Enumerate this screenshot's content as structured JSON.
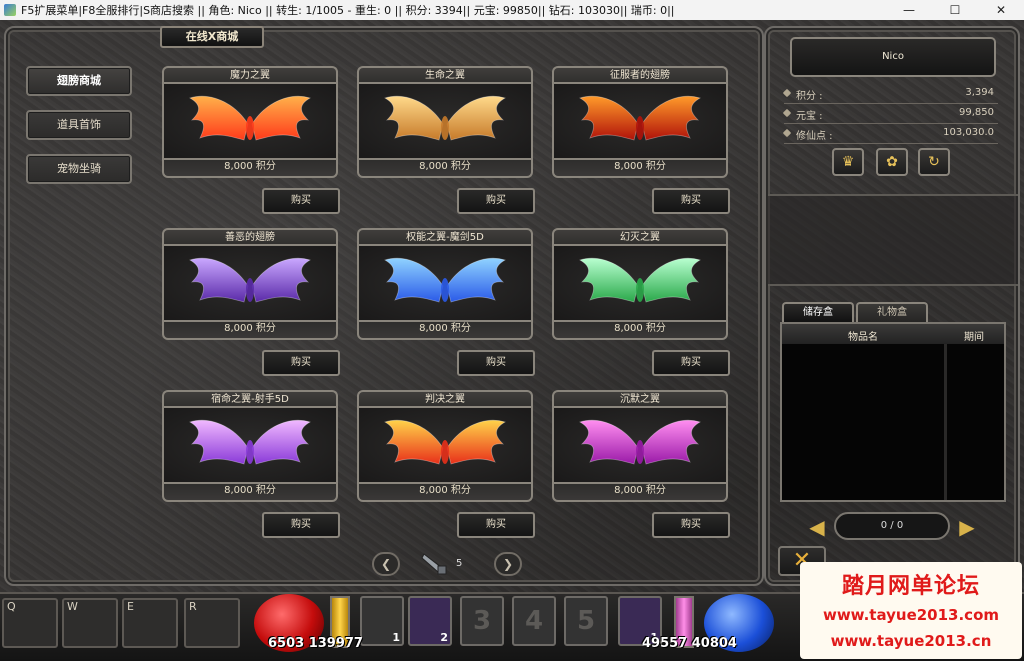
{
  "window": {
    "title": "F5扩展菜单|F8全服排行|S商店搜索 || 角色: Nico || 转生: 1/1005 - 重生: 0 || 积分: 3394|| 元宝: 99850|| 钻石: 103030|| 瑞币: 0||",
    "controls": {
      "minimize": "—",
      "maximize": "☐",
      "close": "✕"
    }
  },
  "shop": {
    "tab_title": "在线X商城",
    "categories": [
      {
        "label": "翅膀商城",
        "active": true
      },
      {
        "label": "道具首饰",
        "active": false
      },
      {
        "label": "宠物坐骑",
        "active": false
      }
    ],
    "buy_label": "购买",
    "items": [
      {
        "name": "魔力之翼",
        "price": "8,000 积分",
        "color_a": "#ffb04a",
        "color_b": "#ff3a1a"
      },
      {
        "name": "生命之翼",
        "price": "8,000 积分",
        "color_a": "#ffd98a",
        "color_b": "#c67a2a"
      },
      {
        "name": "征服者的翅膀",
        "price": "8,000 积分",
        "color_a": "#ff9a2a",
        "color_b": "#b0120a"
      },
      {
        "name": "善恶的翅膀",
        "price": "8,000 积分",
        "color_a": "#c9a7ff",
        "color_b": "#5a2aa8"
      },
      {
        "name": "权能之翼-魔剑5D",
        "price": "8,000 积分",
        "color_a": "#8fd2ff",
        "color_b": "#2a5ae8"
      },
      {
        "name": "幻灭之翼",
        "price": "8,000 积分",
        "color_a": "#b8ffd0",
        "color_b": "#2aa84a"
      },
      {
        "name": "宿命之翼-射手5D",
        "price": "8,000 积分",
        "color_a": "#f0b8ff",
        "color_b": "#8a3ad8"
      },
      {
        "name": "判决之翼",
        "price": "8,000 积分",
        "color_a": "#ffd24a",
        "color_b": "#e8301a"
      },
      {
        "name": "沉默之翼",
        "price": "8,000 积分",
        "color_a": "#ff8ef0",
        "color_b": "#9a1aa8"
      }
    ],
    "pager": {
      "prev": "❮",
      "next": "❯",
      "page": "5"
    }
  },
  "player": {
    "name": "Nico",
    "stats": [
      {
        "label": "积分 :",
        "value": "3,394"
      },
      {
        "label": "元宝 :",
        "value": "99,850"
      },
      {
        "label": "修仙点 :",
        "value": "103,030.0"
      }
    ],
    "actions": [
      "♛",
      "✿",
      "↻"
    ]
  },
  "bag": {
    "tabs": [
      "储存盒",
      "礼物盒"
    ],
    "col_name": "物品名",
    "col_period": "期间",
    "count": "0  /  0",
    "close": "✕",
    "left_arrow": "◀",
    "right_arrow": "▶"
  },
  "hotbar": {
    "keys": [
      "Q",
      "W",
      "E",
      "R"
    ],
    "hp": "6503 139977",
    "mp": "49557 40804",
    "skills": [
      {
        "label": "",
        "count": "1"
      },
      {
        "label": "",
        "count": "2"
      },
      {
        "label": "3",
        "count": ""
      },
      {
        "label": "4",
        "count": ""
      },
      {
        "label": "5",
        "count": ""
      },
      {
        "label": "",
        "count": "1"
      }
    ]
  },
  "watermark": {
    "title": "踏月网单论坛",
    "url1": "www.tayue2013.com",
    "url2": "www.tayue2013.cn"
  }
}
